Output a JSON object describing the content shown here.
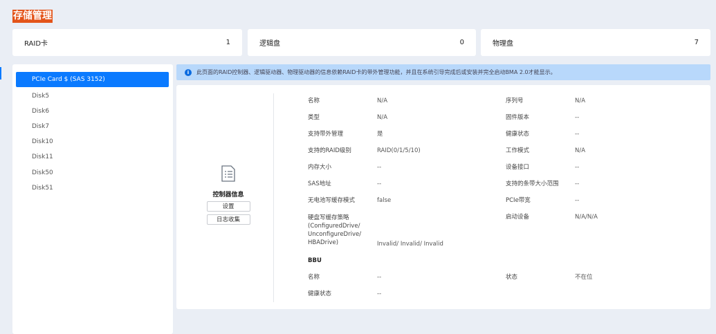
{
  "title": "存储管理",
  "summary": [
    {
      "label": "RAID卡",
      "value": "1"
    },
    {
      "label": "逻辑盘",
      "value": "0"
    },
    {
      "label": "物理盘",
      "value": "7"
    }
  ],
  "list": [
    "PCIe Card $ (SAS 3152)",
    "Disk5",
    "Disk6",
    "Disk7",
    "Disk10",
    "Disk11",
    "Disk50",
    "Disk51"
  ],
  "notice": "此页面的RAID控制器、逻辑驱动器、物理驱动器的信息依赖RAID卡的带外管理功能，并且在系统引导完成后或安装并完全启动BMA 2.0才能显示。",
  "controller": {
    "label": "控制器信息",
    "settings": "设置",
    "log": "日志收集"
  },
  "left_fields": [
    [
      "名称",
      "N/A"
    ],
    [
      "类型",
      "N/A"
    ],
    [
      "支持带外管理",
      "是"
    ],
    [
      "支持的RAID级别",
      "RAID(0/1/5/10)"
    ],
    [
      "内存大小",
      "--"
    ],
    [
      "SAS地址",
      "--"
    ],
    [
      "无电池写缓存模式",
      "false"
    ]
  ],
  "right_fields": [
    [
      "序列号",
      "N/A"
    ],
    [
      "固件版本",
      "--"
    ],
    [
      "健康状态",
      "--"
    ],
    [
      "工作模式",
      "N/A"
    ],
    [
      "设备接口",
      "--"
    ],
    [
      "支持的条带大小范围",
      "--"
    ],
    [
      "PCIe带宽",
      "--"
    ],
    [
      "启动设备",
      "N/A/N/A"
    ]
  ],
  "cache_policy": {
    "label_lines": [
      "硬盘写缓存策略",
      "(ConfiguredDrive/",
      "UnconfigureDrive/",
      "HBADrive)"
    ],
    "value": "Invalid/ Invalid/ Invalid"
  },
  "bbu": {
    "heading": "BBU",
    "name_label": "名称",
    "name_value": "--",
    "state_label": "状态",
    "state_value": "不在位",
    "health_label": "健康状态",
    "health_value": "--"
  }
}
